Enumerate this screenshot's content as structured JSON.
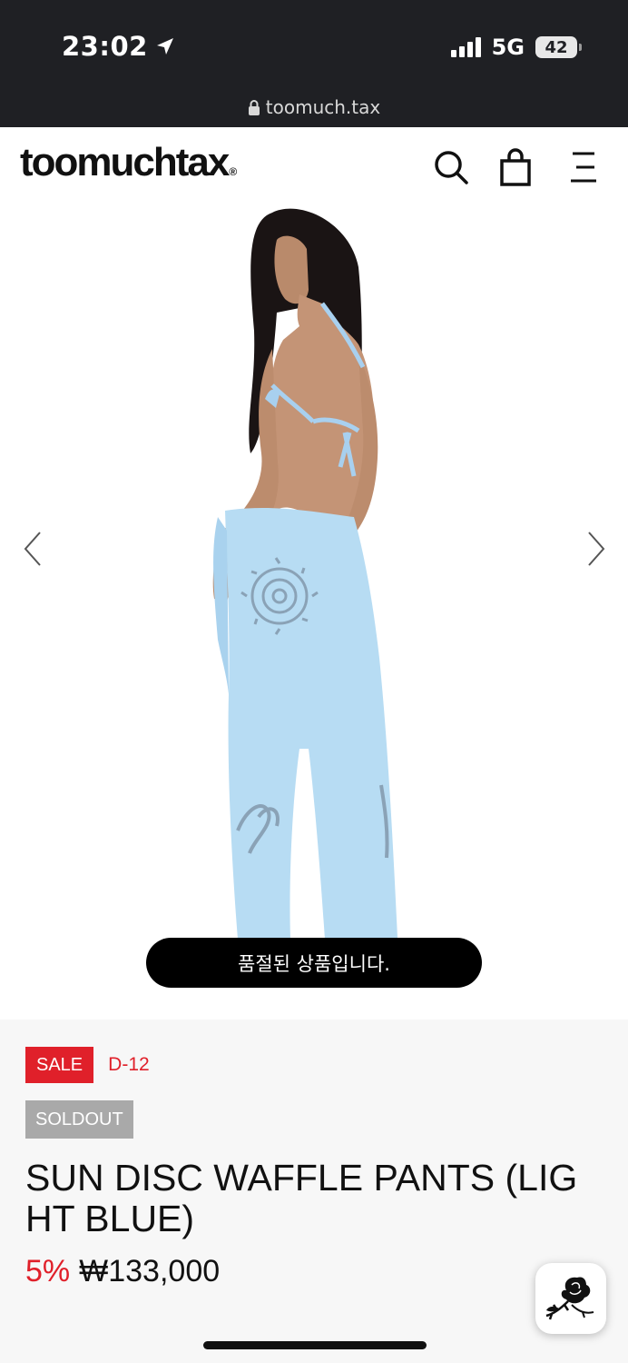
{
  "status_bar": {
    "time": "23:02",
    "network": "5G",
    "battery": "42"
  },
  "browser": {
    "url": "toomuch.tax"
  },
  "header": {
    "logo_text": "toomuchtax",
    "logo_mark": "®"
  },
  "gallery": {
    "toast": "품절된 상품입니다."
  },
  "product": {
    "sale_badge": "SALE",
    "d_day": "D-12",
    "soldout_badge": "SOLDOUT",
    "title": "SUN DISC WAFFLE PANTS (LIGHT BLUE)",
    "discount": "5%",
    "price": "₩133,000"
  },
  "colors": {
    "sale_red": "#e0202a",
    "soldout_gray": "#a9a9a9",
    "pants_blue": "#b7dcf3"
  },
  "icons": [
    "location-arrow-icon",
    "signal-icon",
    "battery-icon",
    "lock-icon",
    "search-icon",
    "cart-icon",
    "menu-icon",
    "chevron-left-icon",
    "chevron-right-icon",
    "rose-icon"
  ]
}
